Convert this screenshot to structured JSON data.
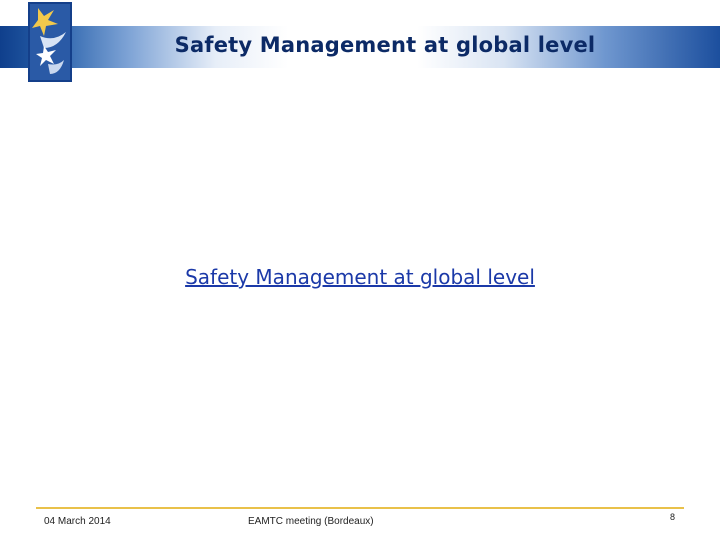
{
  "header": {
    "title": "Safety Management at global level",
    "logo_icon": "easa-stars-logo-icon"
  },
  "main": {
    "link_text": "Safety Management at global level"
  },
  "footer": {
    "date": "04 March 2014",
    "meeting": "EAMTC meeting (Bordeaux)",
    "page_number": "8"
  },
  "colors": {
    "header_blue": "#1c4f9e",
    "title_navy": "#0c2a66",
    "link_blue": "#1b39a8",
    "footer_line_gold": "#e9c14a"
  }
}
